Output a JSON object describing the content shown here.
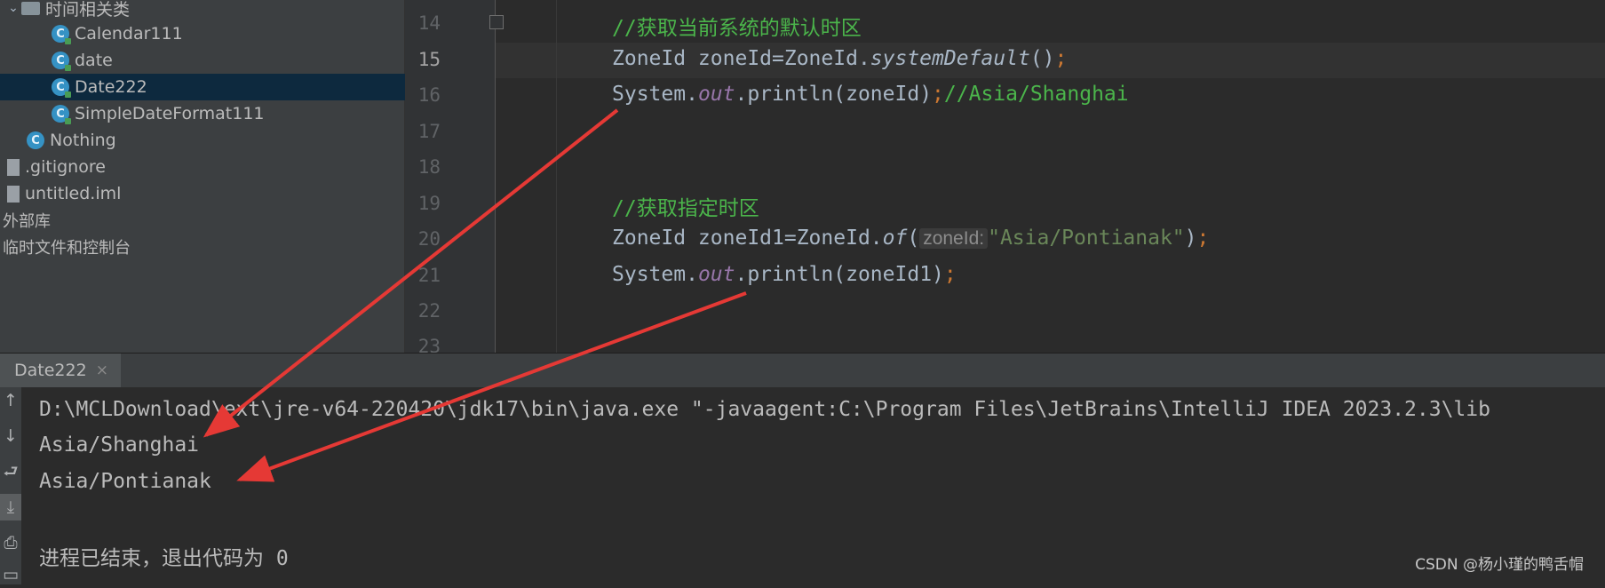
{
  "sidebar": {
    "items": [
      {
        "label": "时间相关类",
        "type": "folder"
      },
      {
        "label": "Calendar111",
        "type": "class"
      },
      {
        "label": "date",
        "type": "class"
      },
      {
        "label": "Date222",
        "type": "class",
        "selected": true
      },
      {
        "label": "SimpleDateFormat111",
        "type": "class"
      },
      {
        "label": "Nothing",
        "type": "class"
      },
      {
        "label": ".gitignore",
        "type": "file"
      },
      {
        "label": "untitled.iml",
        "type": "file"
      },
      {
        "label": "外部库",
        "type": "node"
      },
      {
        "label": "临时文件和控制台",
        "type": "node"
      }
    ]
  },
  "editor": {
    "line_numbers": [
      "14",
      "15",
      "16",
      "17",
      "18",
      "19",
      "20",
      "21",
      "22",
      "23"
    ],
    "current_line": "15",
    "lines": {
      "l14": {
        "comment": "//获取当前系统的默认时区"
      },
      "l15": {
        "p1": "ZoneId zoneId=ZoneId.",
        "method": "systemDefault",
        "p2": "()",
        "semi": ";"
      },
      "l16": {
        "p1": "System.",
        "field": "out",
        "p2": ".println(zoneId)",
        "semi": ";",
        "comment": "//Asia/Shanghai"
      },
      "l19": {
        "comment": "//获取指定时区"
      },
      "l20": {
        "p1": "ZoneId zoneId1=ZoneId.",
        "method": "of",
        "p2": "(",
        "hint": "zoneId:",
        "str": "\"Asia/Pontianak\"",
        "p3": ")",
        "semi": ";"
      },
      "l21": {
        "p1": "System.",
        "field": "out",
        "p2": ".println(zoneId1)",
        "semi": ";"
      }
    }
  },
  "run_panel": {
    "tab_label": "Date222",
    "close_symbol": "×",
    "console": [
      "D:\\MCLDownload\\ext\\jre-v64-220420\\jdk17\\bin\\java.exe \"-javaagent:C:\\Program Files\\JetBrains\\IntelliJ IDEA 2023.2.3\\lib",
      "Asia/Shanghai",
      "Asia/Pontianak",
      "",
      "进程已结束，退出代码为 0"
    ],
    "toolbar_icons": [
      "arrow-up-icon",
      "arrow-down-icon",
      "soft-wrap-icon",
      "scroll-to-end-icon",
      "print-icon",
      "trash-icon"
    ]
  },
  "watermark": "CSDN @杨小瑾的鸭舌帽",
  "colors": {
    "annotation_arrow": "#e53935",
    "comment": "#4bb54b",
    "string": "#6a8759",
    "keyword_semicolon": "#cc7832",
    "field": "#9876aa"
  }
}
